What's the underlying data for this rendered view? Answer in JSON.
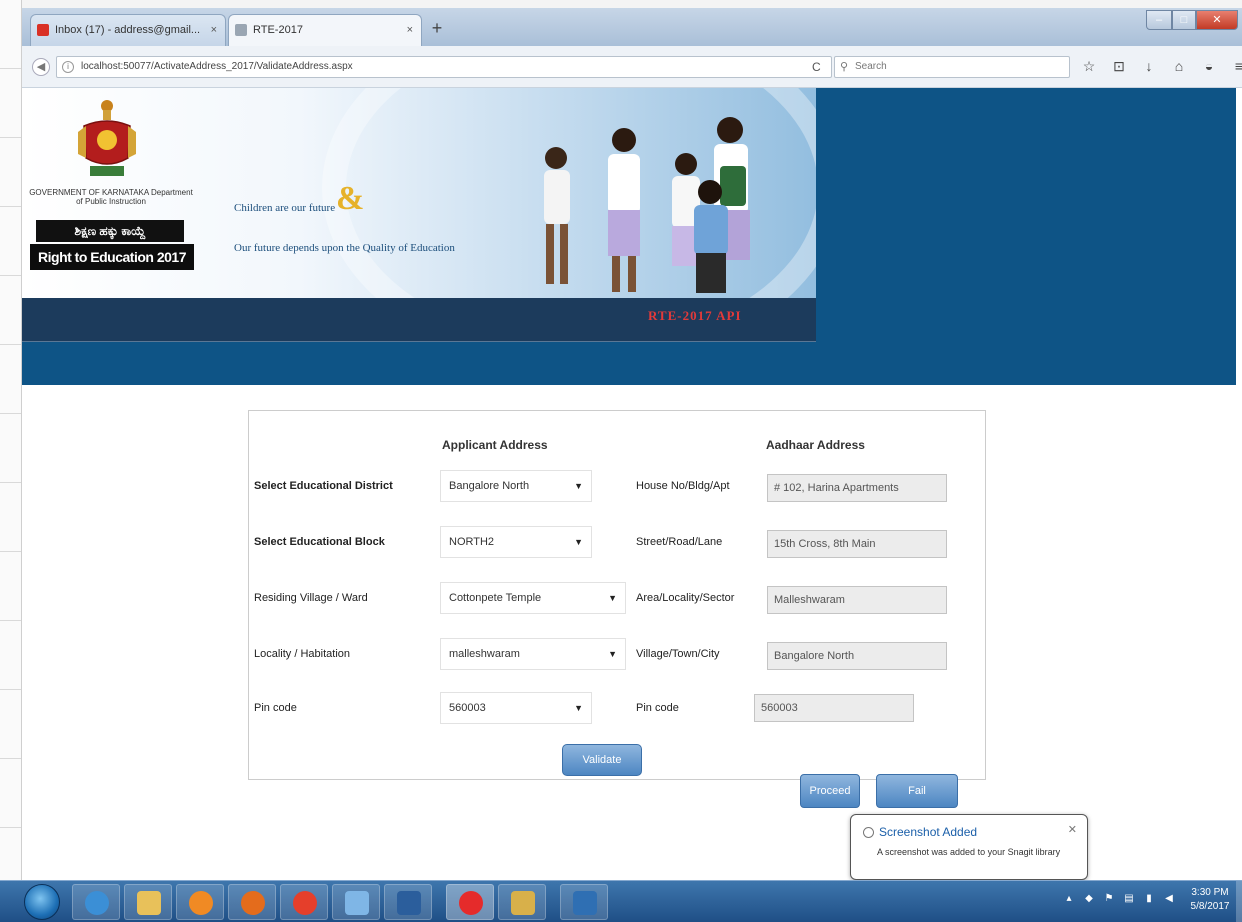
{
  "browser": {
    "tabs": [
      {
        "label": "Inbox (17) - address@gmail...",
        "close": "×"
      },
      {
        "label": "RTE-2017",
        "close": "×"
      }
    ],
    "new_tab": "+",
    "window_controls": {
      "minimize": "–",
      "maximize": "□",
      "close": "✕"
    },
    "url": "localhost:50077/ActivateAddress_2017/ValidateAddress.aspx",
    "reload": "C",
    "search_placeholder": "Search"
  },
  "banner": {
    "gov_name": "GOVERNMENT OF KARNATAKA Department of Public Instruction",
    "kannada_label": "ಶಿಕ್ಷಣ ಹಕ್ಕು ಕಾಯ್ದೆ",
    "rte_label": "Right to Education 2017",
    "tagline_line1": "Children are our future",
    "ampersand": "&",
    "tagline_line2": "Our future depends upon the Quality of Education",
    "api_label": "RTE-2017 API"
  },
  "form": {
    "applicant_header": "Applicant Address",
    "aadhaar_header": "Aadhaar Address",
    "left_labels": [
      "Select Educational District",
      "Select Educational Block",
      "Residing Village / Ward",
      "Locality / Habitation",
      "Pin code"
    ],
    "left_values": [
      "Bangalore North",
      "NORTH2",
      "Cottonpete Temple",
      "malleshwaram",
      "560003"
    ],
    "right_labels": [
      "House No/Bldg/Apt",
      "Street/Road/Lane",
      "Area/Locality/Sector",
      "Village/Town/City",
      "Pin code"
    ],
    "right_values": [
      "# 102, Harina Apartments",
      "15th Cross, 8th Main",
      "Malleshwaram",
      "Bangalore North",
      "560003"
    ],
    "validate_label": "Validate",
    "proceed_label": "Proceed",
    "fail_label": "Fail"
  },
  "notification": {
    "title": "Screenshot Added",
    "body": "A screenshot was added to your Snagit library",
    "close": "✕"
  },
  "taskbar": {
    "clock_time": "3:30 PM",
    "clock_date": "5/8/2017"
  }
}
